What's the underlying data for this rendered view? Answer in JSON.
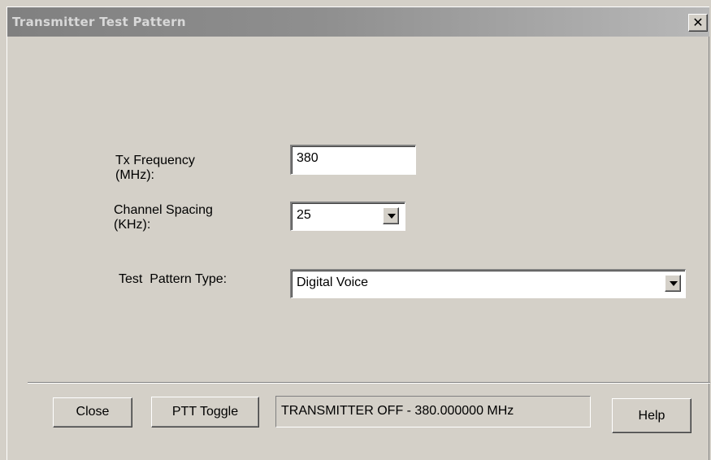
{
  "window": {
    "title": "Transmitter Test Pattern",
    "close_glyph": "✕"
  },
  "form": {
    "tx_frequency": {
      "label_line1": "Tx Frequency",
      "label_line2": "(MHz):",
      "value": "380"
    },
    "channel_spacing": {
      "label_line1": "Channel Spacing",
      "label_line2": "(KHz):",
      "selected": "25"
    },
    "test_pattern_type": {
      "label": "Test  Pattern Type:",
      "selected": "Digital Voice"
    }
  },
  "footer": {
    "close_label": "Close",
    "ptt_toggle_label": "PTT Toggle",
    "status": "TRANSMITTER OFF - 380.000000 MHz",
    "help_label": "Help"
  },
  "icons": {
    "close": "close-icon",
    "dropdown": "chevron-down-icon"
  },
  "colors": {
    "dialog_background": "#d4d0c8",
    "titlebar_inactive": "#808080",
    "field_background": "#ffffff"
  }
}
